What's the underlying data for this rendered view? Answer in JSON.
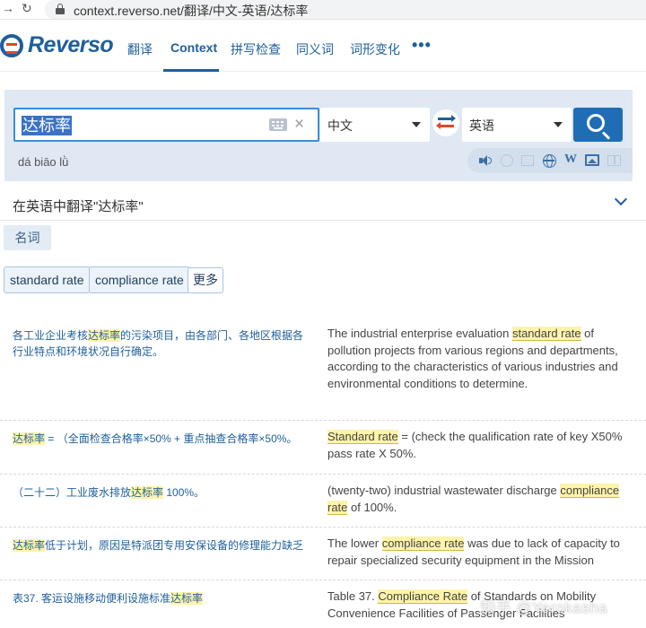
{
  "browser": {
    "url": "context.reverso.net/翻译/中文-英语/达标率"
  },
  "header": {
    "logo_text": "Reverso",
    "nav": [
      "翻译",
      "Context",
      "拼写检查",
      "同义词",
      "词形变化"
    ],
    "more": "•••"
  },
  "search": {
    "query": "达标率",
    "source_lang": "中文",
    "target_lang": "英语",
    "pinyin": "dá biāo lǜ",
    "clear_glyph": "×"
  },
  "translation": {
    "heading": "在英语中翻译\"达标率\"",
    "pos_tab": "名词",
    "suggestions": [
      "standard rate",
      "compliance rate"
    ],
    "more_label": "更多"
  },
  "examples": [
    {
      "src": [
        "各工业企业考核",
        "达标率",
        "的污染项目，由各部门、各地区根据各行业特点和环境状况自行确定。"
      ],
      "tgt": [
        "The industrial enterprise evaluation ",
        "standard rate",
        " of pollution projects from various regions and departments, according to the characteristics of various industries and environmental conditions to determine."
      ]
    },
    {
      "src": [
        "",
        "达标率",
        " = （全面检查合格率×50% + 重点抽查合格率×50%。"
      ],
      "tgt": [
        "",
        "Standard rate",
        " = (check the qualification rate of key X50% pass rate X 50%."
      ]
    },
    {
      "src": [
        "（二十二）工业废水排放",
        "达标率",
        " 100%。"
      ],
      "tgt": [
        "(twenty-two) industrial wastewater discharge ",
        "compliance rate",
        " of 100%."
      ]
    },
    {
      "src": [
        "",
        "达标率",
        "低于计划，原因是特派团专用安保设备的修理能力缺乏"
      ],
      "tgt": [
        "The lower ",
        "compliance rate",
        " was due to lack of capacity to repair specialized security equipment in the Mission"
      ]
    },
    {
      "src": [
        "表37. 客运设施移动便利设施标准",
        "达标率",
        ""
      ],
      "tgt": [
        "Table 37. ",
        "Compliance Rate",
        " of Standards on Mobility Convenience Facilities of Passenger Facilities"
      ]
    }
  ],
  "watermark": "知乎 @Yerokasha"
}
